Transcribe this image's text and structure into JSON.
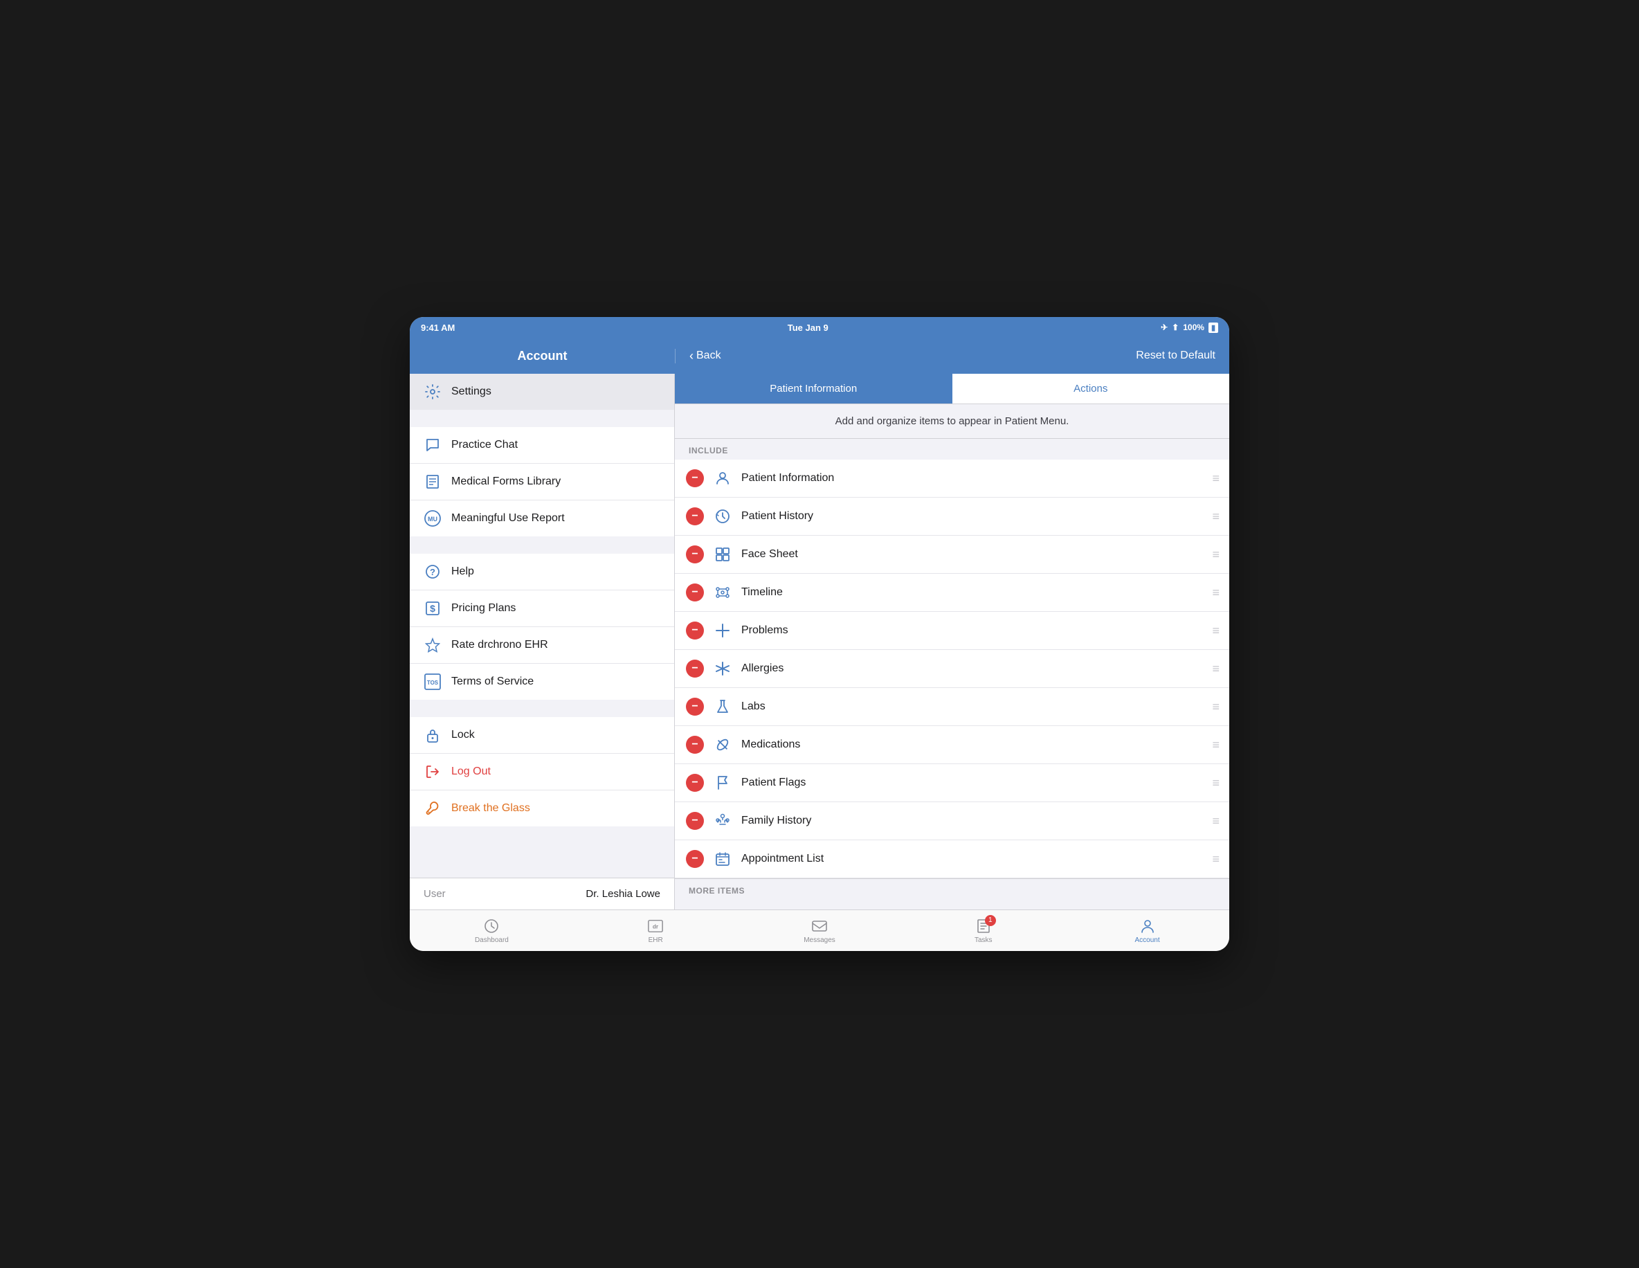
{
  "status_bar": {
    "time": "9:41 AM",
    "date": "Tue Jan 9",
    "battery": "100%"
  },
  "header": {
    "title": "Account",
    "back_label": "Back",
    "reset_label": "Reset to Default"
  },
  "tabs": {
    "patient_information": "Patient Information",
    "actions": "Actions"
  },
  "instruction": "Add and organize items to appear in Patient Menu.",
  "include_section": "INCLUDE",
  "more_items_section": "MORE ITEMS",
  "include_items": [
    {
      "label": "Patient Information",
      "icon": "person"
    },
    {
      "label": "Patient History",
      "icon": "history"
    },
    {
      "label": "Face Sheet",
      "icon": "grid"
    },
    {
      "label": "Timeline",
      "icon": "timeline"
    },
    {
      "label": "Problems",
      "icon": "cross"
    },
    {
      "label": "Allergies",
      "icon": "asterisk"
    },
    {
      "label": "Labs",
      "icon": "flask"
    },
    {
      "label": "Medications",
      "icon": "pill"
    },
    {
      "label": "Patient Flags",
      "icon": "flag"
    },
    {
      "label": "Family History",
      "icon": "family"
    },
    {
      "label": "Appointment List",
      "icon": "appointments"
    }
  ],
  "sidebar": {
    "active_item": "Settings",
    "items_top": [
      {
        "label": "Settings",
        "icon": "gear"
      }
    ],
    "items_mid": [
      {
        "label": "Practice Chat",
        "icon": "chat"
      },
      {
        "label": "Medical Forms Library",
        "icon": "forms"
      },
      {
        "label": "Meaningful Use Report",
        "icon": "mu"
      }
    ],
    "items_help": [
      {
        "label": "Help",
        "icon": "help"
      },
      {
        "label": "Pricing Plans",
        "icon": "dollar"
      },
      {
        "label": "Rate drchrono EHR",
        "icon": "star"
      },
      {
        "label": "Terms of Service",
        "icon": "tos"
      }
    ],
    "items_bottom": [
      {
        "label": "Lock",
        "icon": "lock",
        "style": "normal"
      },
      {
        "label": "Log Out",
        "icon": "logout",
        "style": "red"
      },
      {
        "label": "Break the Glass",
        "icon": "wrench",
        "style": "orange"
      }
    ],
    "user_label": "User",
    "user_value": "Dr. Leshia Lowe"
  },
  "tab_bar": {
    "items": [
      {
        "label": "Dashboard",
        "icon": "dashboard",
        "active": false
      },
      {
        "label": "EHR",
        "icon": "ehr",
        "active": false
      },
      {
        "label": "Messages",
        "icon": "messages",
        "active": false
      },
      {
        "label": "Tasks",
        "icon": "tasks",
        "active": false,
        "badge": "1"
      },
      {
        "label": "Account",
        "icon": "account",
        "active": true
      }
    ]
  }
}
